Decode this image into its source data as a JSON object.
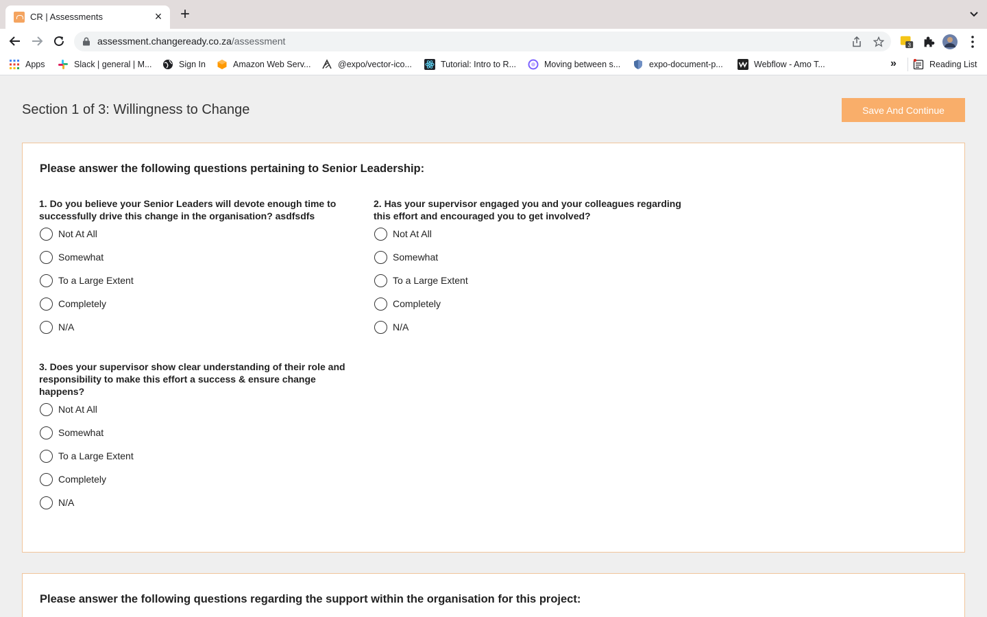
{
  "browser": {
    "tab_title": "CR | Assessments",
    "url_host": "assessment.changeready.co.za",
    "url_path": "/assessment",
    "extension_badge": "3",
    "bookmarks": [
      {
        "label": "Apps",
        "icon": "apps-grid-icon",
        "color": "#4285f4"
      },
      {
        "label": "Slack | general | M...",
        "icon": "slack-icon",
        "color": "#e01e5a"
      },
      {
        "label": "Sign In",
        "icon": "globe-icon",
        "color": "#202124"
      },
      {
        "label": "Amazon Web Serv...",
        "icon": "aws-icon",
        "color": "#ff9900"
      },
      {
        "label": "@expo/vector-ico...",
        "icon": "expo-icon",
        "color": "#333333"
      },
      {
        "label": "Tutorial: Intro to R...",
        "icon": "react-icon",
        "color": "#20232a"
      },
      {
        "label": "Moving between s...",
        "icon": "circle-icon",
        "color": "#7b61ff"
      },
      {
        "label": "expo-document-p...",
        "icon": "shield-icon",
        "color": "#4a6fa5"
      },
      {
        "label": "Webflow - Amo T...",
        "icon": "webflow-icon",
        "color": "#222222"
      }
    ],
    "reading_list": "Reading List"
  },
  "page": {
    "section_title": "Section 1 of 3: Willingness to Change",
    "save_button": "Save And Continue",
    "accent_color": "#f9ae6a"
  },
  "card1": {
    "heading": "Please answer the following questions pertaining to Senior Leadership:",
    "questions": [
      {
        "text": "1. Do you believe your Senior Leaders will devote enough time to successfully drive this change in the organisation? asdfsdfs",
        "options": [
          "Not At All",
          "Somewhat",
          "To a Large Extent",
          "Completely",
          "N/A"
        ]
      },
      {
        "text": "2. Has your supervisor engaged you and your colleagues regarding this effort and encouraged you to get involved?",
        "options": [
          "Not At All",
          "Somewhat",
          "To a Large Extent",
          "Completely",
          "N/A"
        ]
      },
      {
        "text": "3. Does your supervisor show clear understanding of their role and responsibility to make this effort a success & ensure change happens?",
        "options": [
          "Not At All",
          "Somewhat",
          "To a Large Extent",
          "Completely",
          "N/A"
        ]
      }
    ]
  },
  "card2": {
    "heading": "Please answer the following questions regarding the support within the organisation for this project:"
  }
}
